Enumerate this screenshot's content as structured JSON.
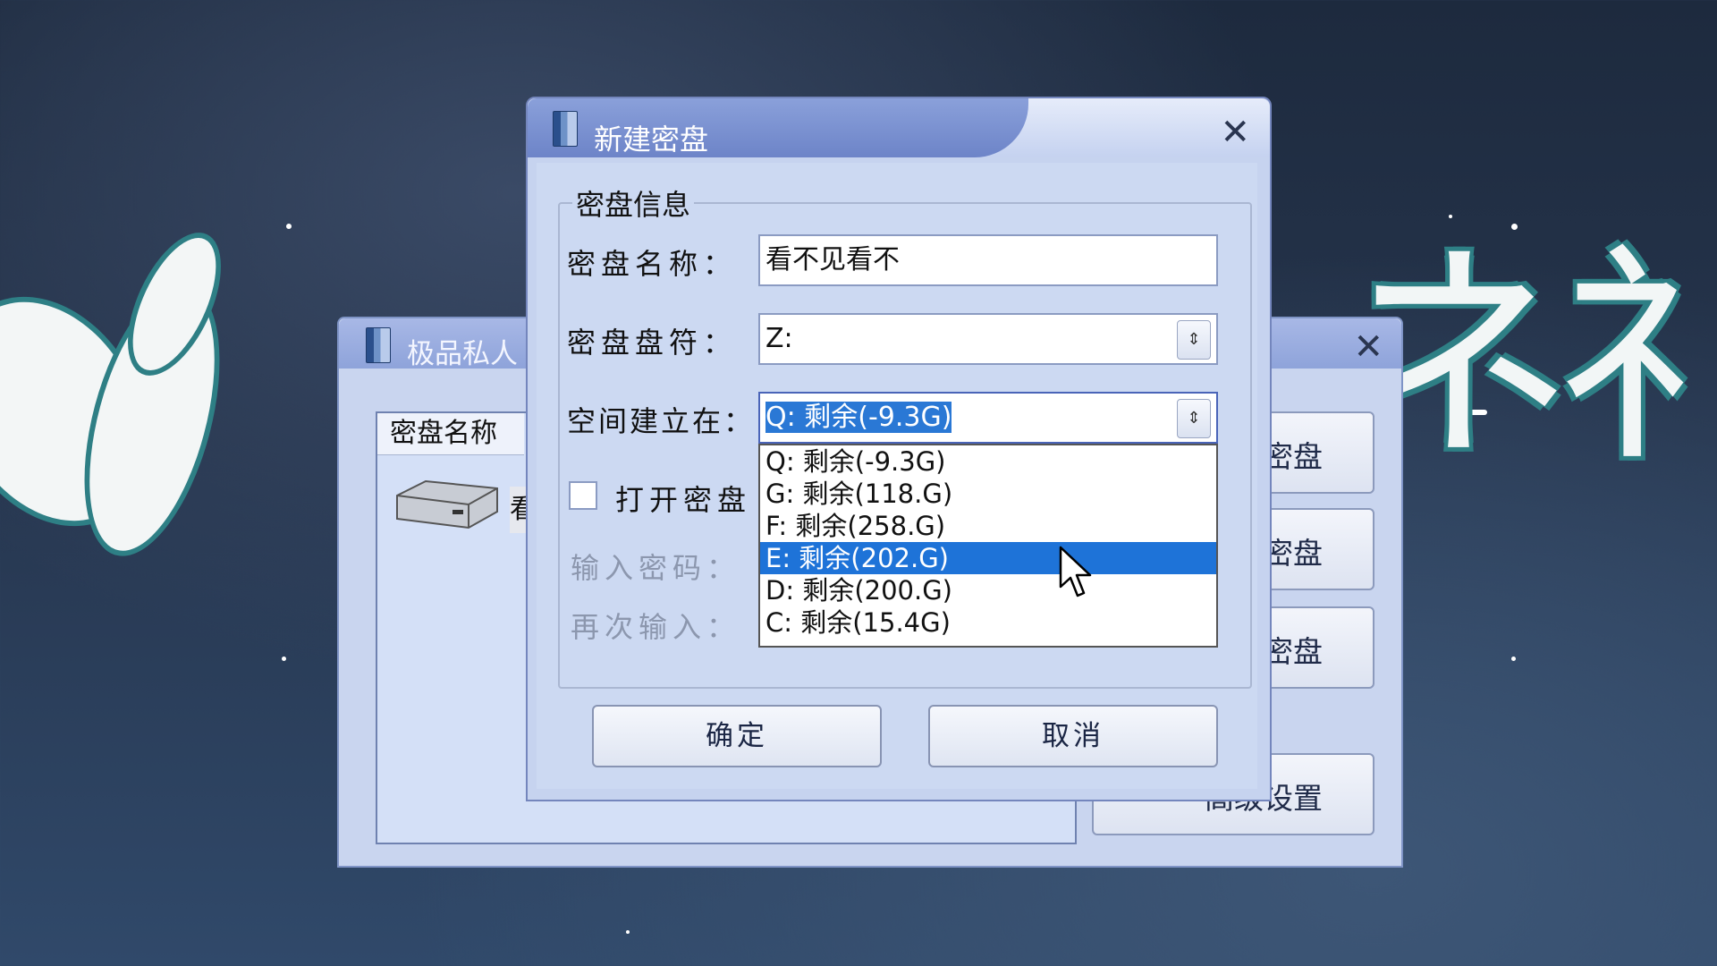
{
  "back_window": {
    "title": "极品私人",
    "list_header": "密盘名称",
    "row_text": "看",
    "side_buttons": [
      "密盘",
      "密盘",
      "密盘",
      "高级设置"
    ]
  },
  "dialog": {
    "title": "新建密盘",
    "group_label": "密盘信息",
    "name_label": "密盘名称：",
    "name_value": "看不见看不",
    "drive_label": "密盘盘符：",
    "drive_value": "Z:",
    "location_label": "空间建立在：",
    "location_value": "Q:  剩余(-9.3G)",
    "dropdown_options": [
      "Q:  剩余(-9.3G)",
      "G:  剩余(118.G)",
      "F:  剩余(258.G)",
      "E:  剩余(202.G)",
      "D:  剩余(200.G)",
      "C:  剩余(15.4G)"
    ],
    "selected_option_index": 3,
    "open_label": "打开密盘",
    "password_label": "输入密码：",
    "confirm_label": "再次输入：",
    "ok_button": "确定",
    "cancel_button": "取消"
  },
  "icons": [
    "app-icon",
    "close-icon",
    "disk-icon",
    "spin-icon",
    "checkbox-icon",
    "mouse-cursor-icon"
  ],
  "colors": {
    "selection": "#1e73d8",
    "dialog_bg": "#ccd9f2",
    "title_blue": "#7a90d0"
  }
}
